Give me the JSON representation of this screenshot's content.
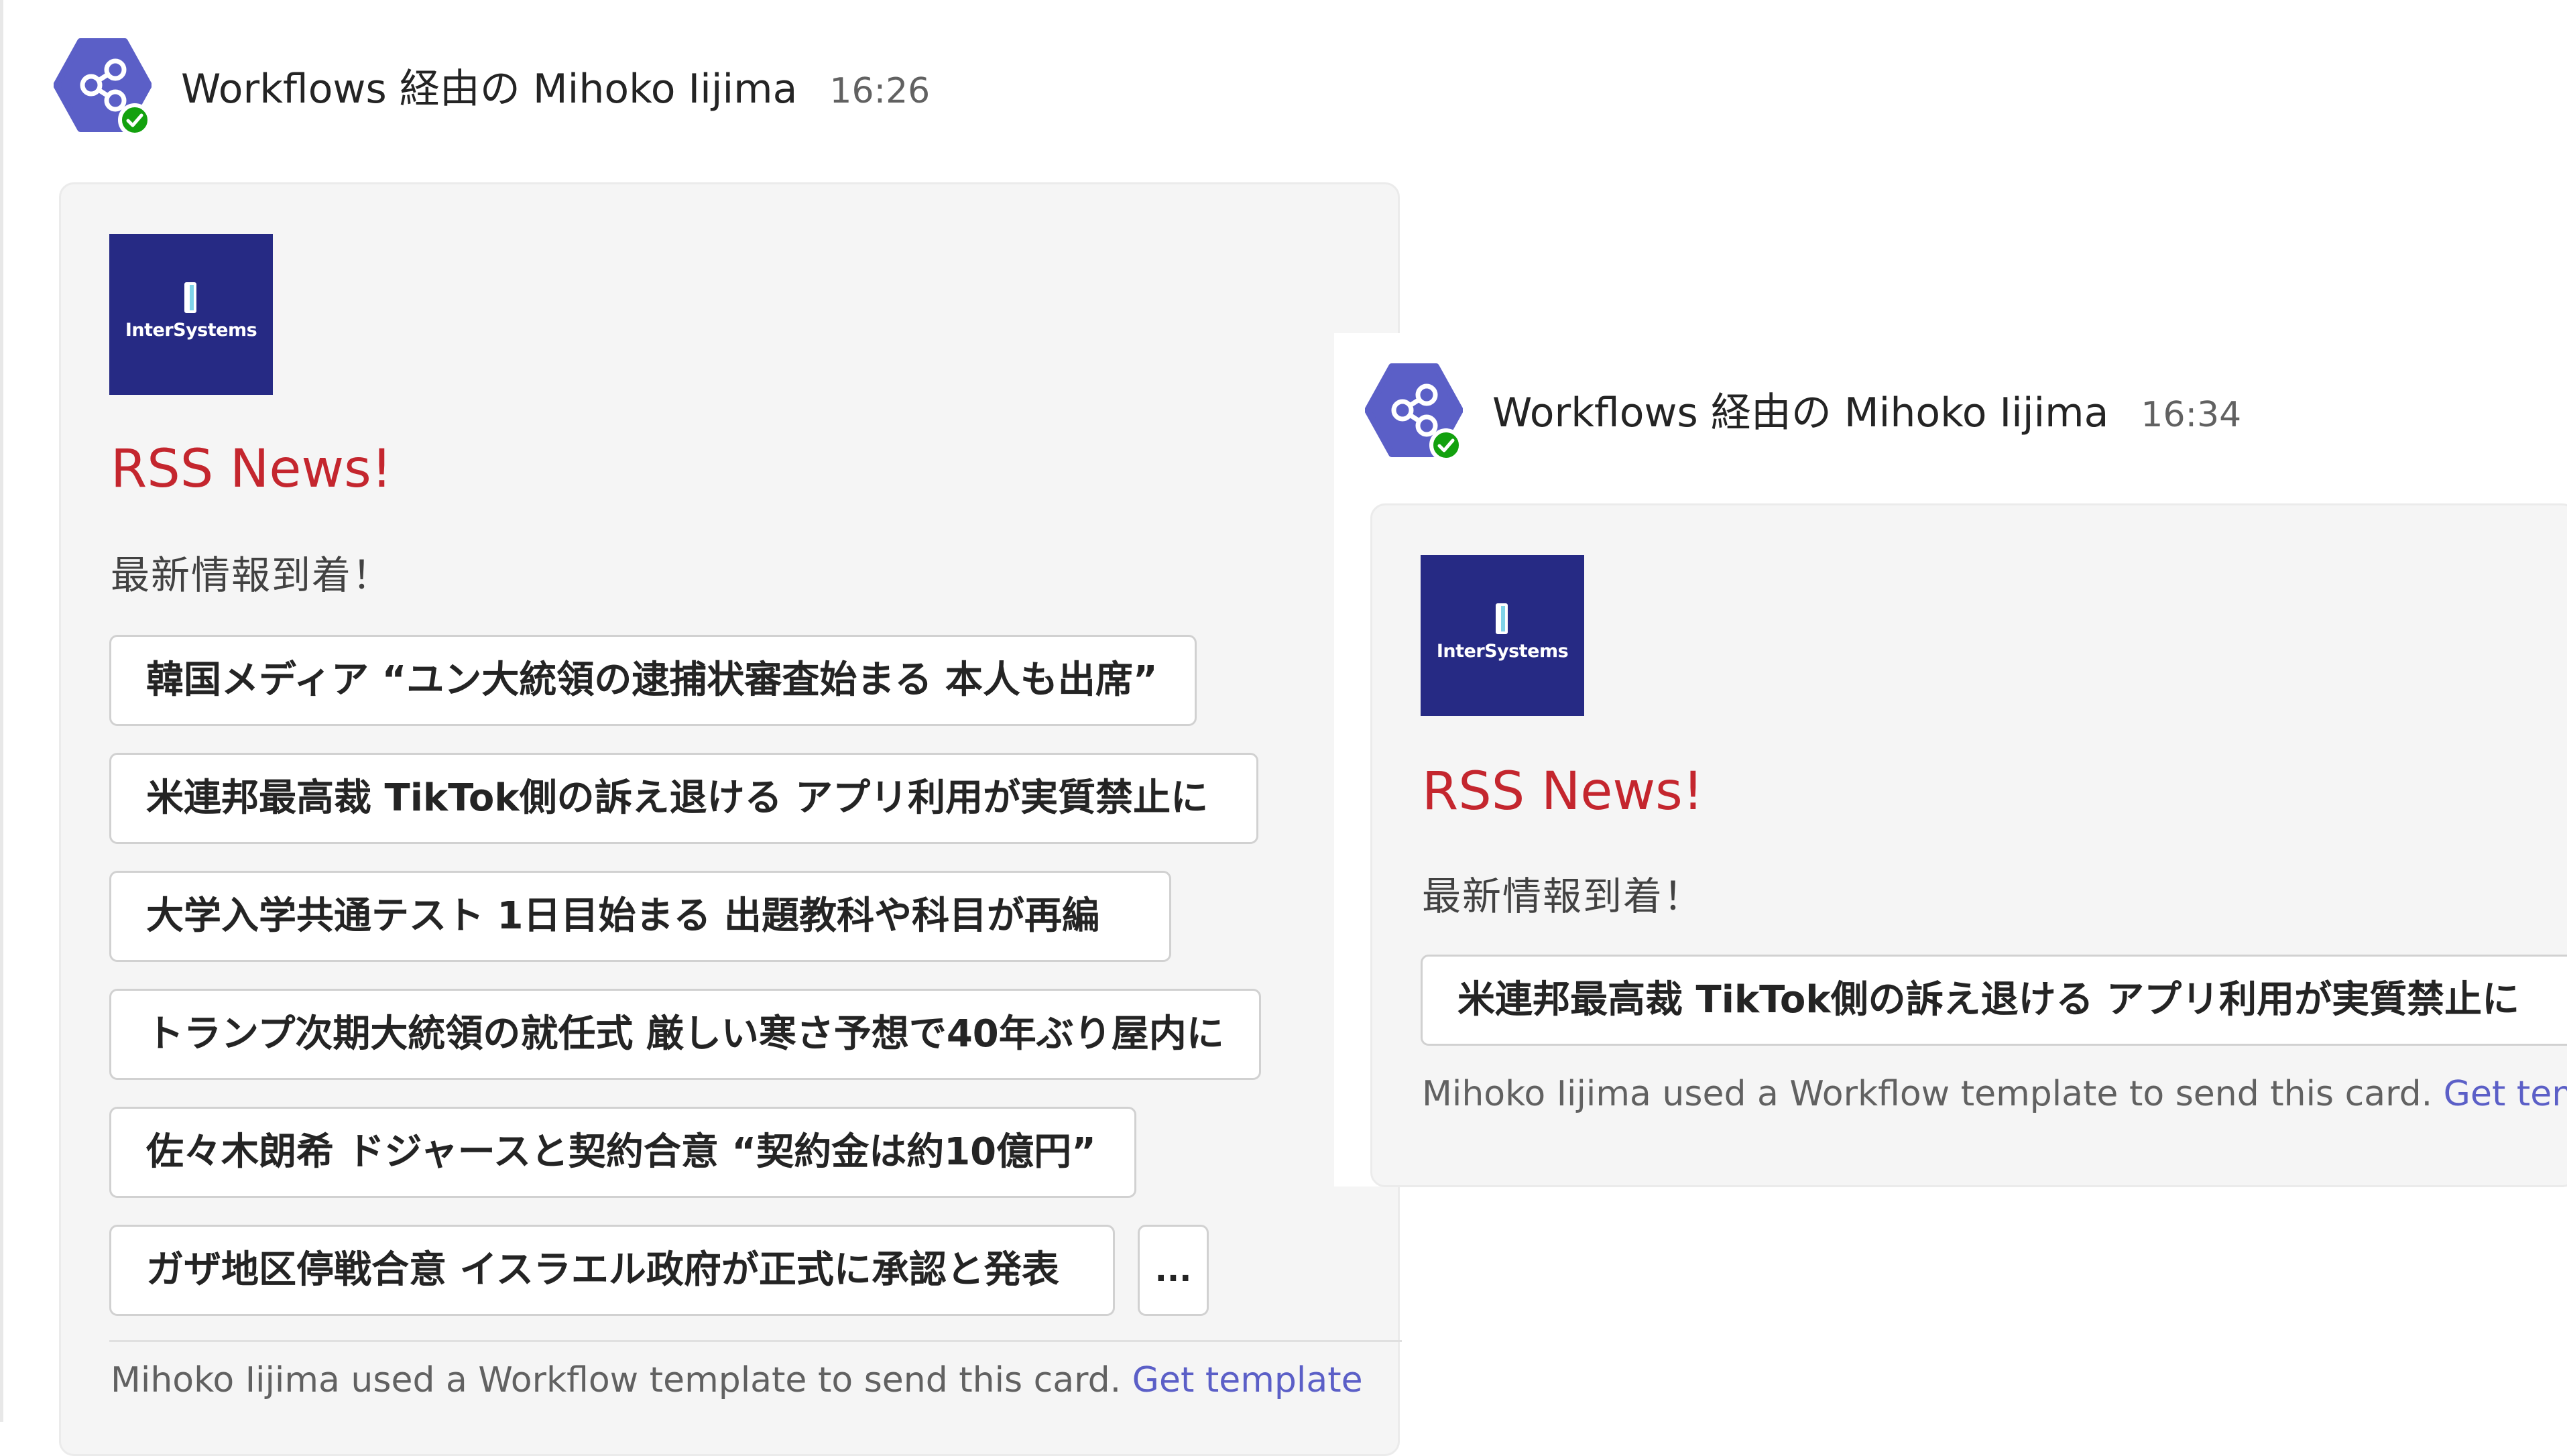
{
  "message1": {
    "sender": "Workflows 経由の Mihoko Iijima",
    "time": "16:26",
    "card": {
      "logo_text": "InterSystems",
      "title": "RSS News!",
      "subtitle": "最新情報到着！",
      "news_items": [
        "韓国メディア “ユン大統領の逮捕状審査始まる 本人も出席”",
        "米連邦最高裁 TikTok側の訴え退ける アプリ利用が実質禁止に",
        "大学入学共通テスト 1日目始まる 出題教科や科目が再編",
        "トランプ次期大統領の就任式 厳しい寒さ予想で40年ぶり屋内に",
        "佐々木朗希 ドジャースと契約合意 “契約金は約10億円”",
        "ガザ地区停戦合意 イスラエル政府が正式に承認と発表"
      ],
      "more_label": "...",
      "footer_text": "Mihoko Iijima used a Workflow template to send this card.",
      "footer_link": "Get template"
    }
  },
  "message2": {
    "sender": "Workflows 経由の Mihoko Iijima",
    "time": "16:34",
    "card": {
      "logo_text": "InterSystems",
      "title": "RSS News!",
      "subtitle": "最新情報到着！",
      "news_items": [
        "米連邦最高裁 TikTok側の訴え退ける アプリ利用が実質禁止に"
      ],
      "footer_text": "Mihoko Iijima used a Workflow template to send this card.",
      "footer_link": "Get template"
    }
  },
  "colors": {
    "avatar_bg": "#5b5fc7",
    "presence": "#13a10e",
    "title_red": "#c4262e",
    "link": "#5b5fc7",
    "logo_bg": "#262a84"
  },
  "icons": {
    "avatar": "share-network-icon",
    "presence": "checkmark-icon"
  }
}
